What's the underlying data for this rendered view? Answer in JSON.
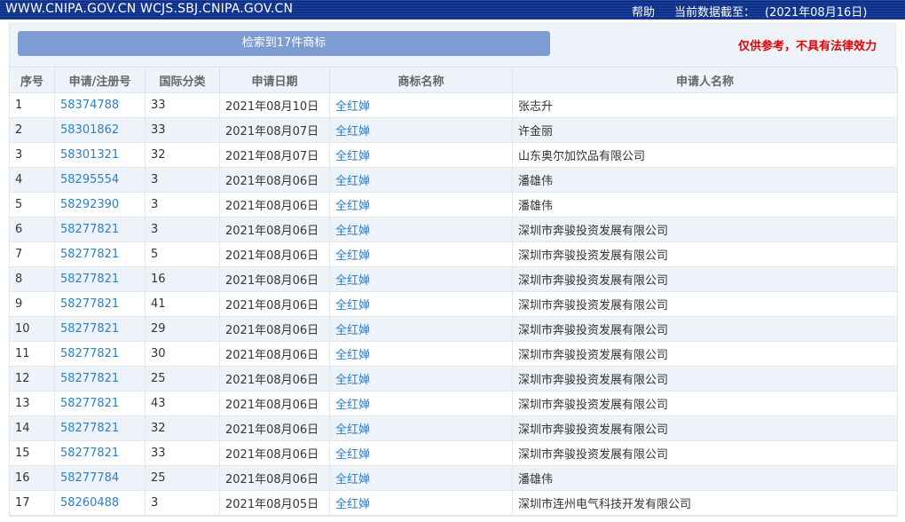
{
  "header": {
    "sites": "WWW.CNIPA.GOV.CN WCJS.SBJ.CNIPA.GOV.CN",
    "help": "帮助",
    "date_label": "当前数据截至：",
    "date_value": "(2021年08月16日)"
  },
  "search": {
    "result_label": "检索到17件商标",
    "disclaimer": "仅供参考，不具有法律效力"
  },
  "table": {
    "columns": [
      "序号",
      "申请/注册号",
      "国际分类",
      "申请日期",
      "商标名称",
      "申请人名称"
    ],
    "rows": [
      {
        "no": "1",
        "reg": "58374788",
        "cls": "33",
        "date": "2021年08月10日",
        "mark": "全红婵",
        "applicant": "张志升"
      },
      {
        "no": "2",
        "reg": "58301862",
        "cls": "33",
        "date": "2021年08月07日",
        "mark": "全红婵",
        "applicant": "许金丽"
      },
      {
        "no": "3",
        "reg": "58301321",
        "cls": "32",
        "date": "2021年08月07日",
        "mark": "全红婵",
        "applicant": "山东奥尔加饮品有限公司"
      },
      {
        "no": "4",
        "reg": "58295554",
        "cls": "3",
        "date": "2021年08月06日",
        "mark": "全红婵",
        "applicant": "潘雄伟"
      },
      {
        "no": "5",
        "reg": "58292390",
        "cls": "3",
        "date": "2021年08月06日",
        "mark": "全红婵",
        "applicant": "潘雄伟"
      },
      {
        "no": "6",
        "reg": "58277821",
        "cls": "3",
        "date": "2021年08月06日",
        "mark": "全红婵",
        "applicant": "深圳市奔骏投资发展有限公司"
      },
      {
        "no": "7",
        "reg": "58277821",
        "cls": "5",
        "date": "2021年08月06日",
        "mark": "全红婵",
        "applicant": "深圳市奔骏投资发展有限公司"
      },
      {
        "no": "8",
        "reg": "58277821",
        "cls": "16",
        "date": "2021年08月06日",
        "mark": "全红婵",
        "applicant": "深圳市奔骏投资发展有限公司"
      },
      {
        "no": "9",
        "reg": "58277821",
        "cls": "41",
        "date": "2021年08月06日",
        "mark": "全红婵",
        "applicant": "深圳市奔骏投资发展有限公司"
      },
      {
        "no": "10",
        "reg": "58277821",
        "cls": "29",
        "date": "2021年08月06日",
        "mark": "全红婵",
        "applicant": "深圳市奔骏投资发展有限公司"
      },
      {
        "no": "11",
        "reg": "58277821",
        "cls": "30",
        "date": "2021年08月06日",
        "mark": "全红婵",
        "applicant": "深圳市奔骏投资发展有限公司"
      },
      {
        "no": "12",
        "reg": "58277821",
        "cls": "25",
        "date": "2021年08月06日",
        "mark": "全红婵",
        "applicant": "深圳市奔骏投资发展有限公司"
      },
      {
        "no": "13",
        "reg": "58277821",
        "cls": "43",
        "date": "2021年08月06日",
        "mark": "全红婵",
        "applicant": "深圳市奔骏投资发展有限公司"
      },
      {
        "no": "14",
        "reg": "58277821",
        "cls": "32",
        "date": "2021年08月06日",
        "mark": "全红婵",
        "applicant": "深圳市奔骏投资发展有限公司"
      },
      {
        "no": "15",
        "reg": "58277821",
        "cls": "33",
        "date": "2021年08月06日",
        "mark": "全红婵",
        "applicant": "深圳市奔骏投资发展有限公司"
      },
      {
        "no": "16",
        "reg": "58277784",
        "cls": "25",
        "date": "2021年08月06日",
        "mark": "全红婵",
        "applicant": "潘雄伟"
      },
      {
        "no": "17",
        "reg": "58260488",
        "cls": "3",
        "date": "2021年08月05日",
        "mark": "全红婵",
        "applicant": "深圳市连州电气科技开发有限公司"
      }
    ]
  },
  "colors": {
    "header_bg": "#0b2f8a",
    "button_bg": "#7c9cd2",
    "link": "#2a7fc9",
    "disclaimer": "#e10000",
    "row_alt": "#eef3fa"
  }
}
